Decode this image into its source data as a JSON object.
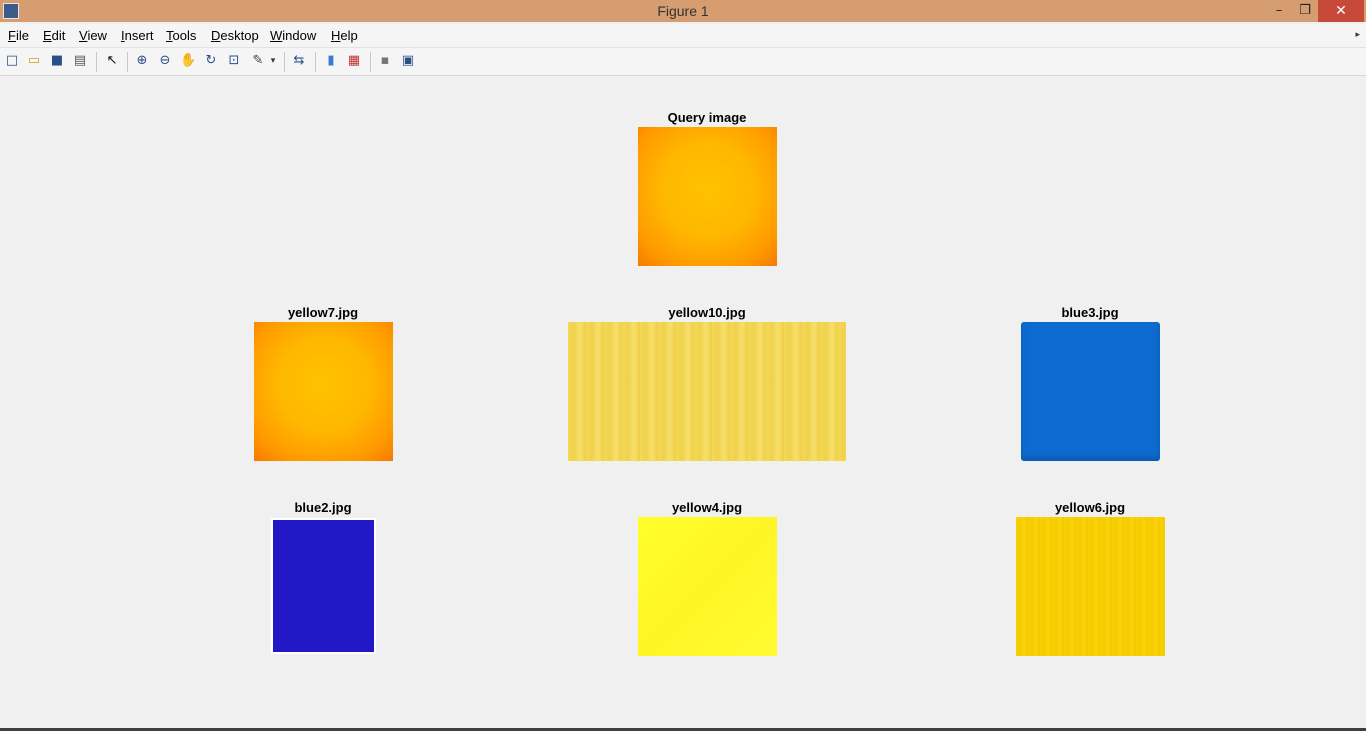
{
  "window": {
    "title": "Figure 1",
    "controls": {
      "minimize": "–",
      "restore": "❐",
      "close": "✕"
    }
  },
  "menu": {
    "items": [
      {
        "label": "File",
        "mnemonic": "F",
        "rest": "ile"
      },
      {
        "label": "Edit",
        "mnemonic": "E",
        "rest": "dit"
      },
      {
        "label": "View",
        "mnemonic": "V",
        "rest": "iew"
      },
      {
        "label": "Insert",
        "mnemonic": "I",
        "rest": "nsert"
      },
      {
        "label": "Tools",
        "mnemonic": "T",
        "rest": "ools"
      },
      {
        "label": "Desktop",
        "mnemonic": "D",
        "rest": "esktop"
      },
      {
        "label": "Window",
        "mnemonic": "W",
        "rest": "indow"
      },
      {
        "label": "Help",
        "mnemonic": "H",
        "rest": "elp"
      }
    ],
    "overflow_icon": "▸"
  },
  "toolbar": {
    "icons": [
      "new-figure-icon",
      "open-file-icon",
      "save-icon",
      "print-icon",
      "edit-plot-icon",
      "zoom-in-icon",
      "zoom-out-icon",
      "pan-icon",
      "rotate-3d-icon",
      "data-cursor-icon",
      "brush-icon",
      "link-plot-icon",
      "colorbar-icon",
      "legend-icon",
      "hide-plot-tools-icon",
      "show-plot-tools-icon"
    ],
    "glyphs": {
      "new": "□",
      "open": "▭",
      "save": "■",
      "print": "▤",
      "pointer": "↖",
      "zoom_in": "⊕",
      "zoom_out": "⊖",
      "pan": "✋",
      "rotate": "↻",
      "data_cursor": "⊡",
      "brush": "✎",
      "dropdown": "▾",
      "link": "⇆",
      "colorbar": "▮",
      "legend": "▦",
      "hide": "▪",
      "show": "▣"
    }
  },
  "figure": {
    "panels": [
      {
        "id": "query",
        "title": "Query image",
        "image": "orange-yellow radial burst"
      },
      {
        "id": "yellow7",
        "title": "yellow7.jpg",
        "image": "orange-yellow radial burst"
      },
      {
        "id": "yellow10",
        "title": "yellow10.jpg",
        "image": "yellow painted texture"
      },
      {
        "id": "blue3",
        "title": "blue3.jpg",
        "image": "blue square"
      },
      {
        "id": "blue2",
        "title": "blue2.jpg",
        "image": "dark blue rectangle"
      },
      {
        "id": "yellow4",
        "title": "yellow4.jpg",
        "image": "bright yellow texture"
      },
      {
        "id": "yellow6",
        "title": "yellow6.jpg",
        "image": "golden yellow wood texture"
      }
    ]
  }
}
